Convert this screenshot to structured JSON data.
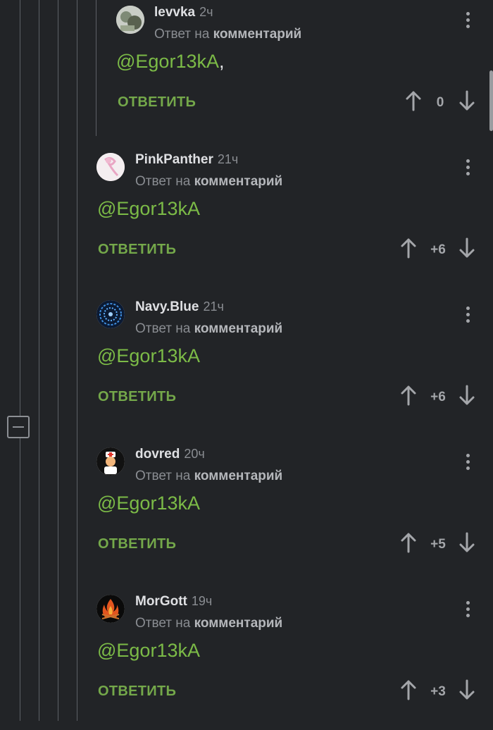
{
  "thread": {
    "collapse_icon": "minus-box-icon",
    "colors": {
      "background": "#222427",
      "accent": "#7cbb47",
      "reply": "#74a84a",
      "muted": "#8a8d92"
    }
  },
  "comments": [
    {
      "username": "levvka",
      "time": "2ч",
      "reply_prefix": "Ответ на",
      "reply_target": "комментарий",
      "mention": "@Egor13kA",
      "mention_tail": ",",
      "reply_label": "ОТВЕТИТЬ",
      "rating": "0"
    },
    {
      "username": "PinkPanther",
      "time": "21ч",
      "reply_prefix": "Ответ на",
      "reply_target": "комментарий",
      "mention": "@Egor13kA",
      "mention_tail": "",
      "reply_label": "ОТВЕТИТЬ",
      "rating": "+6"
    },
    {
      "username": "Navy.Blue",
      "time": "21ч",
      "reply_prefix": "Ответ на",
      "reply_target": "комментарий",
      "mention": "@Egor13kA",
      "mention_tail": "",
      "reply_label": "ОТВЕТИТЬ",
      "rating": "+6"
    },
    {
      "username": "dovred",
      "time": "20ч",
      "reply_prefix": "Ответ на",
      "reply_target": "комментарий",
      "mention": "@Egor13kA",
      "mention_tail": "",
      "reply_label": "ОТВЕТИТЬ",
      "rating": "+5"
    },
    {
      "username": "MorGott",
      "time": "19ч",
      "reply_prefix": "Ответ на",
      "reply_target": "комментарий",
      "mention": "@Egor13kA",
      "mention_tail": "",
      "reply_label": "ОТВЕТИТЬ",
      "rating": "+3"
    }
  ]
}
